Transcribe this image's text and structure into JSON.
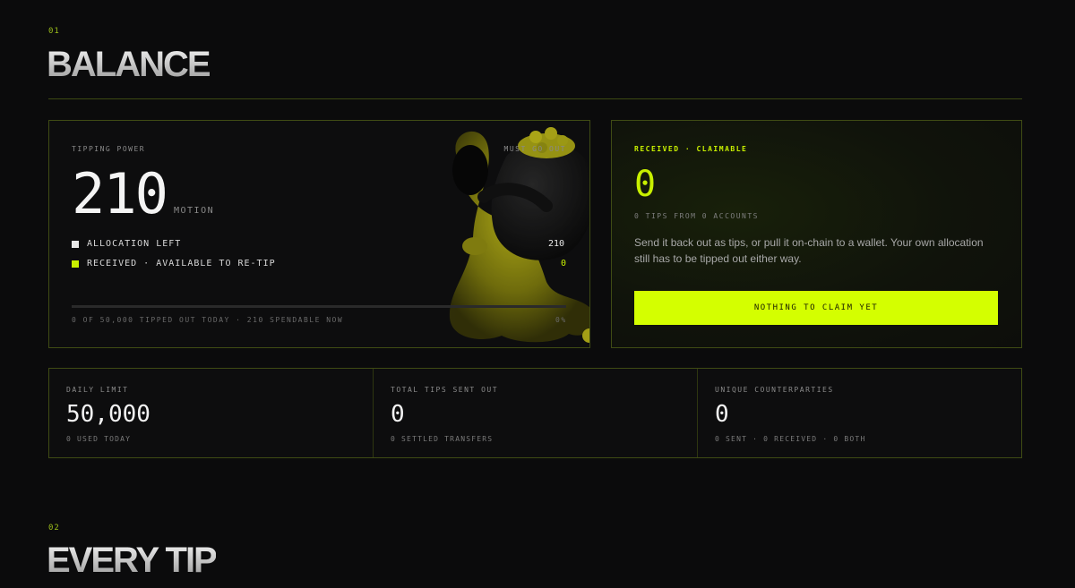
{
  "sections": [
    {
      "number": "01",
      "title": "BALANCE"
    },
    {
      "number": "02",
      "title": "EVERY TIP"
    }
  ],
  "power_card": {
    "label": "TIPPING POWER",
    "corner_label": "MUST GO OUT",
    "value": "210",
    "unit": "MOTION",
    "legend": [
      {
        "label": "ALLOCATION LEFT",
        "value": "210",
        "color": "#e8e8e8"
      },
      {
        "label": "RECEIVED · AVAILABLE TO RE-TIP",
        "value": "0",
        "color": "#c8f000"
      }
    ],
    "progress_fraction": 0,
    "footer_text": "0 OF 50,000 TIPPED OUT TODAY · 210 SPENDABLE NOW",
    "footer_pct": "0%",
    "mascot_icon": "money-bag-mascot"
  },
  "claim_card": {
    "title": "RECEIVED · CLAIMABLE",
    "value": "0",
    "subtitle": "0 TIPS FROM 0 ACCOUNTS",
    "description": "Send it back out as tips, or pull it on-chain to a wallet. Your own allocation still has to be tipped out either way.",
    "button_label": "NOTHING TO CLAIM YET"
  },
  "stats": [
    {
      "label": "DAILY LIMIT",
      "value": "50,000",
      "sub": "0 USED TODAY"
    },
    {
      "label": "TOTAL TIPS SENT OUT",
      "value": "0",
      "sub": "0 SETTLED TRANSFERS"
    },
    {
      "label": "UNIQUE COUNTERPARTIES",
      "value": "0",
      "sub": "0 SENT · 0 RECEIVED · 0 BOTH"
    }
  ],
  "colors": {
    "accent": "#d4ff00",
    "border": "#3f4b14",
    "background": "#0b0b0c"
  }
}
